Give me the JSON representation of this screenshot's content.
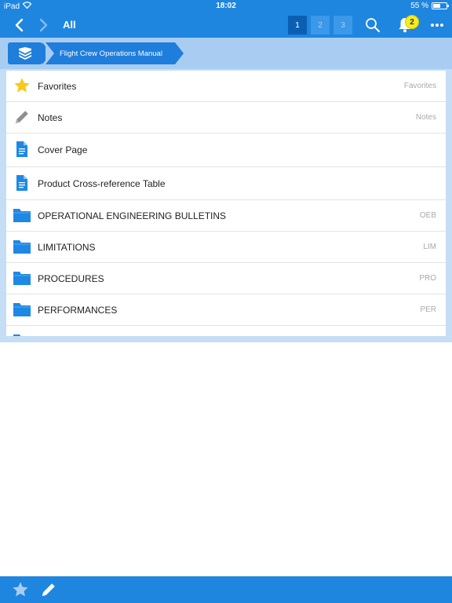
{
  "status_bar": {
    "device": "iPad",
    "time": "18:02",
    "battery": "55 %",
    "battery_level": 0.55
  },
  "toolbar": {
    "title": "All",
    "pages": [
      "1",
      "2",
      "3"
    ],
    "active_page": "1",
    "notification_count": "2"
  },
  "breadcrumb": {
    "current": "Flight Crew Operations Manual"
  },
  "list": {
    "items": [
      {
        "label": "Favorites",
        "code": "Favorites",
        "icon": "star-icon"
      },
      {
        "label": "Notes",
        "code": "Notes",
        "icon": "pencil-icon"
      },
      {
        "label": "Cover Page",
        "code": "",
        "icon": "document-icon"
      },
      {
        "label": "Product Cross-reference Table",
        "code": "",
        "icon": "document-icon"
      },
      {
        "label": "OPERATIONAL ENGINEERING BULLETINS",
        "code": "OEB",
        "icon": "folder-icon"
      },
      {
        "label": "LIMITATIONS",
        "code": "LIM",
        "icon": "folder-icon"
      },
      {
        "label": "PROCEDURES",
        "code": "PRO",
        "icon": "folder-icon"
      },
      {
        "label": "PERFORMANCES",
        "code": "PER",
        "icon": "folder-icon"
      }
    ]
  },
  "colors": {
    "primary": "#1f86e0",
    "breadcrumb_bg": "#a9cdf2",
    "star": "#f8c81c",
    "folder": "#1e88e5",
    "badge": "#f6ec20"
  }
}
